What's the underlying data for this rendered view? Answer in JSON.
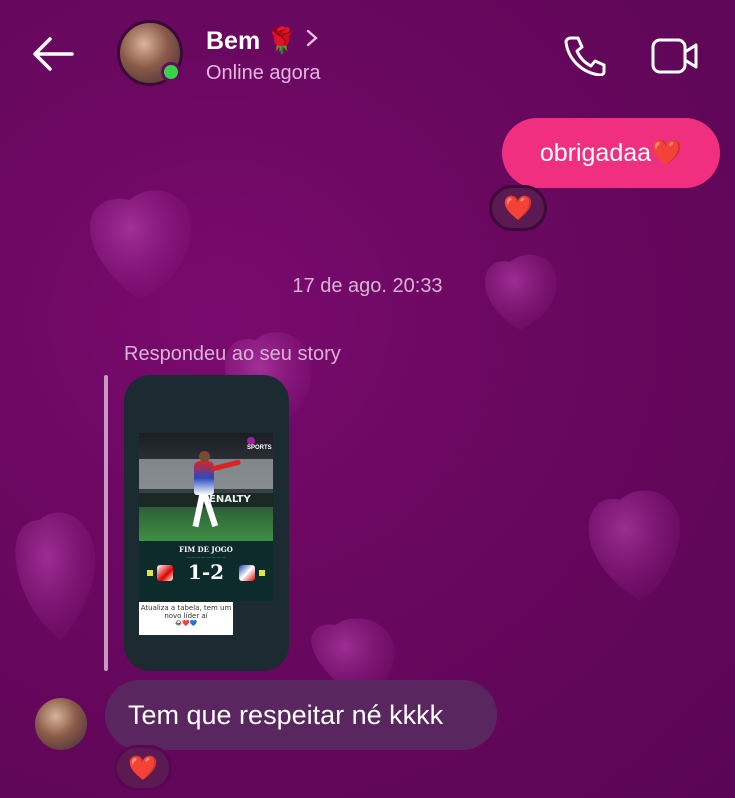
{
  "header": {
    "contact_name": "Bem",
    "name_emoji": "🌹",
    "status": "Online agora",
    "icons": {
      "back": "arrow-left-icon",
      "chevron": "chevron-right-icon",
      "call": "phone-icon",
      "video": "video-camera-icon"
    }
  },
  "messages": {
    "sent": {
      "text": "obrigadaa❤️",
      "reaction": "❤️"
    },
    "timestamp": "17 de ago. 20:33",
    "story_reply_label": "Respondeu ao seu story",
    "story": {
      "headline": "FIM DE JOGO",
      "score": "1-2",
      "ad_text": "ENALTY",
      "brand": "SPORTS",
      "caption": "Atualiza a tabela, tem um novo líder aí",
      "caption_emojis": "😂❤️💙"
    },
    "received": {
      "text": "Tem que respeitar né kkkk",
      "reaction": "❤️"
    }
  },
  "colors": {
    "background": "#6a0860",
    "sent_bubble": "#f0307f",
    "received_bubble": "#5a2660",
    "online": "#3ad14a"
  }
}
